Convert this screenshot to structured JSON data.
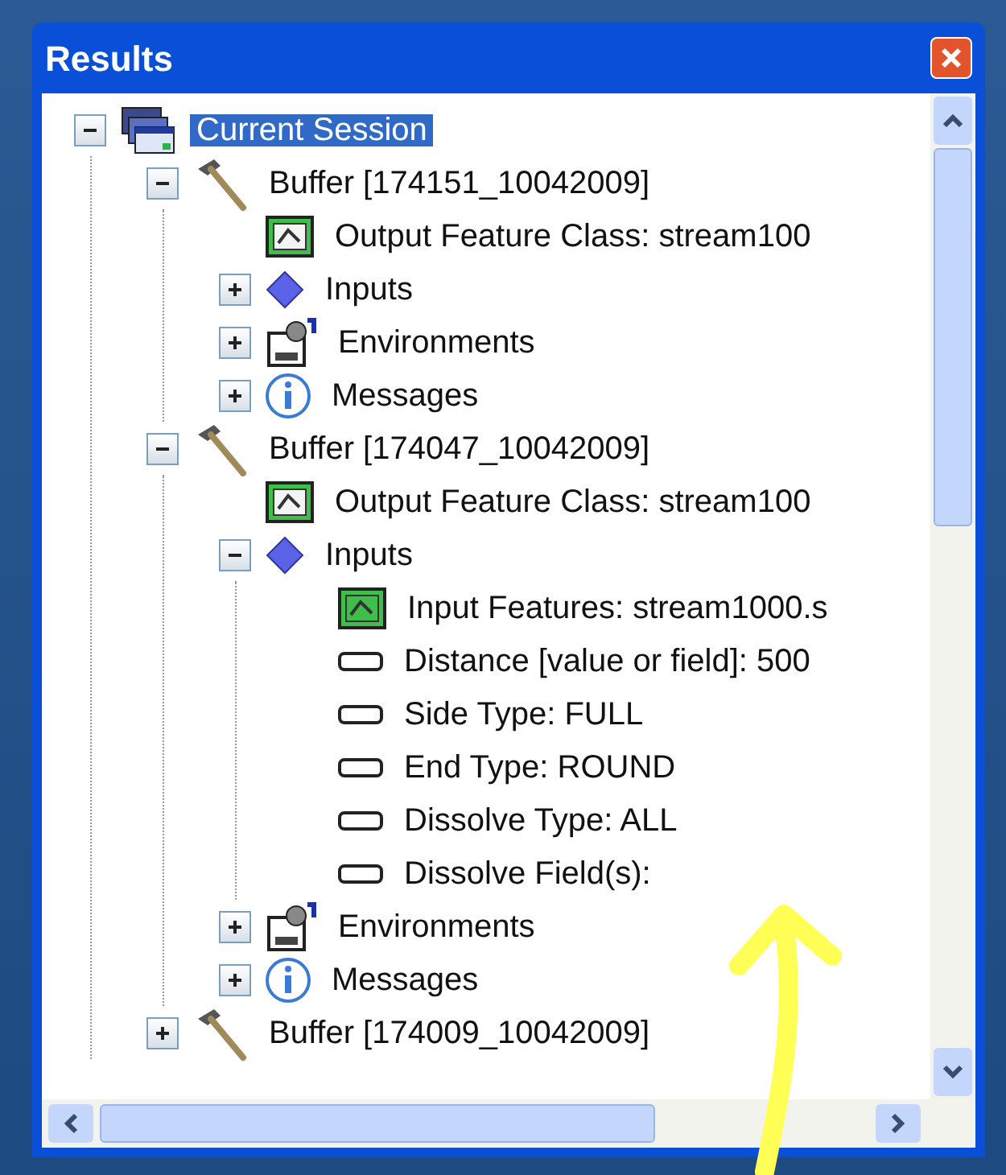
{
  "window": {
    "title": "Results"
  },
  "tree": [
    {
      "label": "Current Session",
      "kind": "session",
      "expanded": true,
      "selected": true,
      "children": [
        {
          "label": "Buffer [174151_10042009]",
          "kind": "tool",
          "expanded": true,
          "selected": false,
          "children": [
            {
              "label": "Output Feature Class: stream100",
              "kind": "output",
              "selected": false
            },
            {
              "label": "Inputs",
              "kind": "inputs",
              "expanded": false,
              "selected": false
            },
            {
              "label": "Environments",
              "kind": "environments",
              "expanded": false,
              "selected": false
            },
            {
              "label": "Messages",
              "kind": "messages",
              "expanded": false,
              "selected": false
            }
          ]
        },
        {
          "label": "Buffer [174047_10042009]",
          "kind": "tool",
          "expanded": true,
          "selected": false,
          "children": [
            {
              "label": "Output Feature Class: stream100",
              "kind": "output",
              "selected": false
            },
            {
              "label": "Inputs",
              "kind": "inputs",
              "expanded": true,
              "selected": false,
              "children": [
                {
                  "label": "Input Features: stream1000.s",
                  "kind": "feature",
                  "selected": false
                },
                {
                  "label": "Distance [value or field]: 500",
                  "kind": "param",
                  "selected": false
                },
                {
                  "label": "Side Type: FULL",
                  "kind": "param",
                  "selected": false
                },
                {
                  "label": "End Type: ROUND",
                  "kind": "param",
                  "selected": false
                },
                {
                  "label": "Dissolve Type: ALL",
                  "kind": "param",
                  "selected": false
                },
                {
                  "label": "Dissolve Field(s):",
                  "kind": "param",
                  "selected": false
                }
              ]
            },
            {
              "label": "Environments",
              "kind": "environments",
              "expanded": false,
              "selected": false
            },
            {
              "label": "Messages",
              "kind": "messages",
              "expanded": false,
              "selected": false
            }
          ]
        },
        {
          "label": "Buffer [174009_10042009]",
          "kind": "tool",
          "expanded": false,
          "selected": false
        }
      ]
    }
  ]
}
